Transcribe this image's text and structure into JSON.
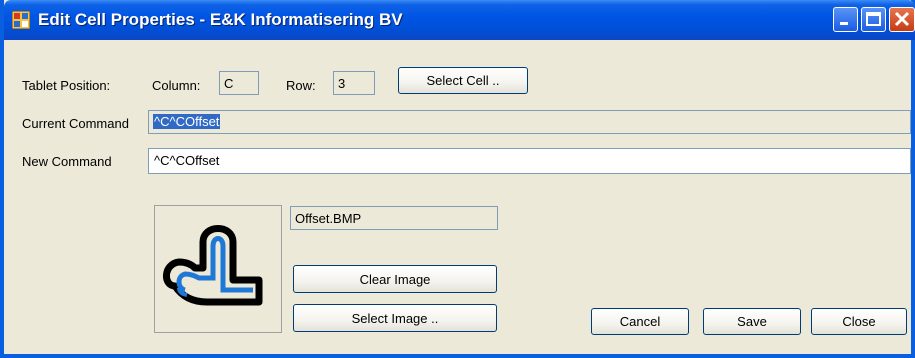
{
  "window": {
    "title": "Edit Cell Properties - E&K Informatisering BV",
    "icon": "app-window-icon",
    "controls": [
      "minimize-icon",
      "maximize-icon",
      "close-icon"
    ]
  },
  "tablet_position": {
    "label": "Tablet Position:",
    "column_label": "Column:",
    "column_value": "C",
    "row_label": "Row:",
    "row_value": "3",
    "select_cell_button": "Select Cell .."
  },
  "current_command": {
    "label": "Current Command",
    "value": "^C^COffset"
  },
  "new_command": {
    "label": "New Command",
    "value": "^C^COffset"
  },
  "image": {
    "preview_icon": "offset-command-icon",
    "filename": "Offset.BMP",
    "clear_button": "Clear Image",
    "select_button": "Select Image .."
  },
  "actions": {
    "cancel": "Cancel",
    "save": "Save",
    "close": "Close"
  },
  "colors": {
    "titlebar": "#0055e5",
    "window_bg": "#ece9d8",
    "selection": "#316ac5",
    "icon_blue": "#1e78d6"
  }
}
